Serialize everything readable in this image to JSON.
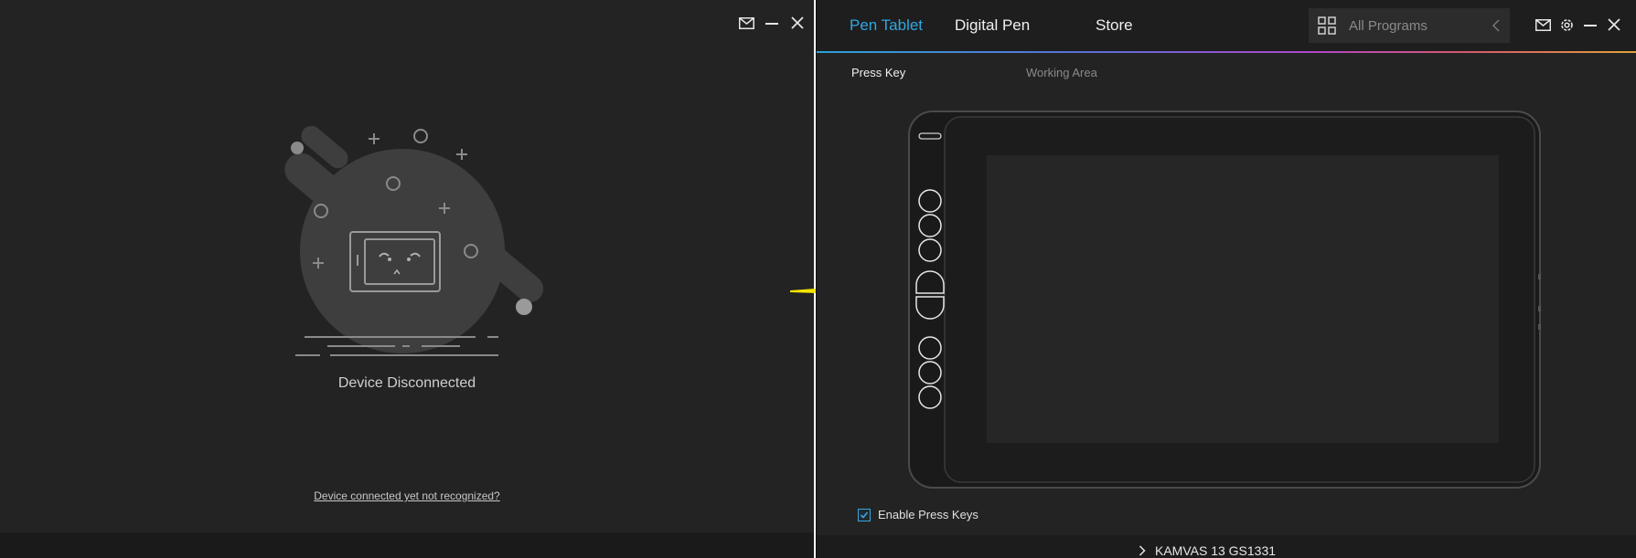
{
  "left_window": {
    "status_text": "Device Disconnected",
    "help_link": "Device connected yet not recognized?",
    "icons": [
      "mail-icon",
      "minimize-icon",
      "close-icon"
    ]
  },
  "right_window": {
    "tabs": [
      {
        "label": "Pen Tablet",
        "active": true
      },
      {
        "label": "Digital Pen",
        "active": false
      },
      {
        "label": "Store",
        "active": false
      }
    ],
    "program_selector": {
      "placeholder": "All Programs"
    },
    "subtabs": [
      {
        "label": "Press Key",
        "active": true
      },
      {
        "label": "Working Area",
        "active": false
      }
    ],
    "enable_press_keys": {
      "label": "Enable Press Keys",
      "checked": true
    },
    "device_name": "KAMVAS 13 GS1331",
    "icons": [
      "mail-icon",
      "gear-icon",
      "minimize-icon",
      "close-icon"
    ]
  },
  "colors": {
    "accent": "#31a6e2",
    "arrow": "#f5e400",
    "background": "#232323"
  }
}
